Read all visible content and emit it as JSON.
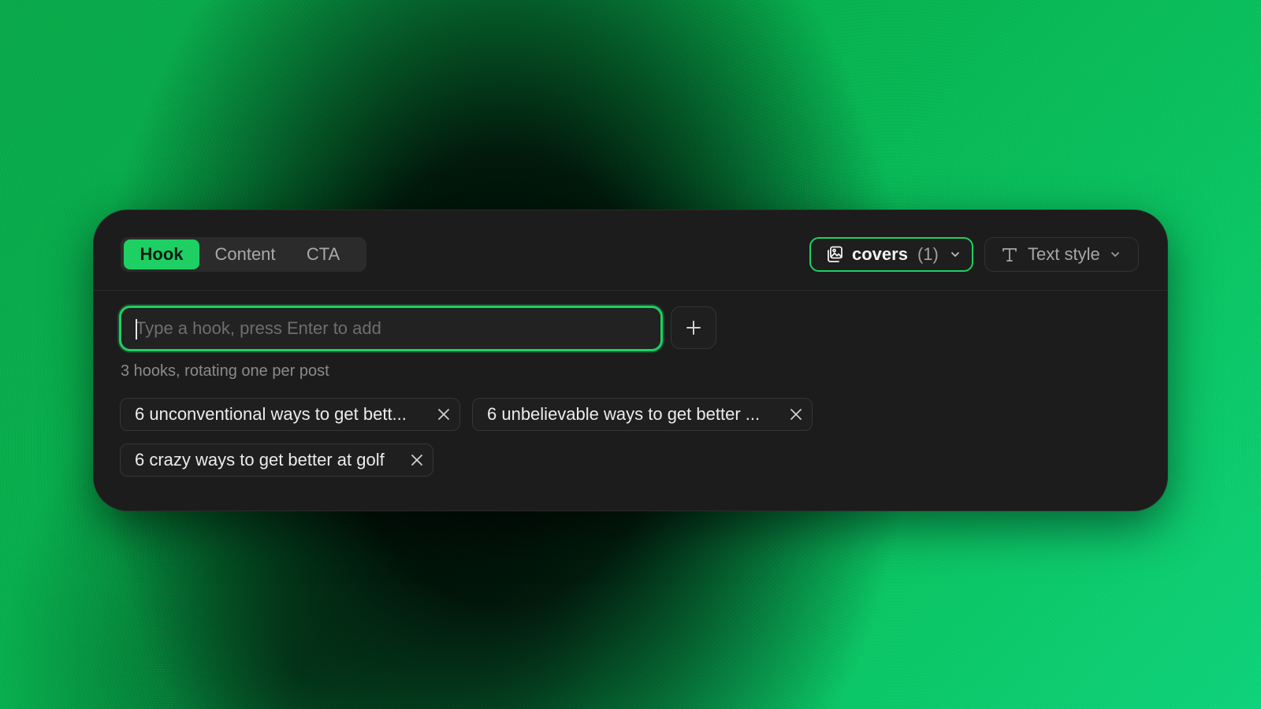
{
  "tabs": [
    {
      "label": "Hook",
      "active": true
    },
    {
      "label": "Content",
      "active": false
    },
    {
      "label": "CTA",
      "active": false
    }
  ],
  "covers_button": {
    "label": "covers",
    "count": "(1)",
    "icon": "image-stack-icon"
  },
  "text_style_button": {
    "label": "Text style",
    "icon": "text-t-icon"
  },
  "hook_input": {
    "value": "",
    "placeholder": "Type a hook, press Enter to add"
  },
  "add_button": {
    "icon": "plus-icon"
  },
  "status_text": "3 hooks, rotating one per post",
  "hooks": [
    {
      "label": "6 unconventional ways to get bett..."
    },
    {
      "label": "6 unbelievable ways to get better ..."
    },
    {
      "label": "6 crazy ways to get better at golf"
    }
  ],
  "colors": {
    "accent": "#1ed063",
    "panel_bg": "#1c1c1c",
    "chip_border": "#363636"
  }
}
